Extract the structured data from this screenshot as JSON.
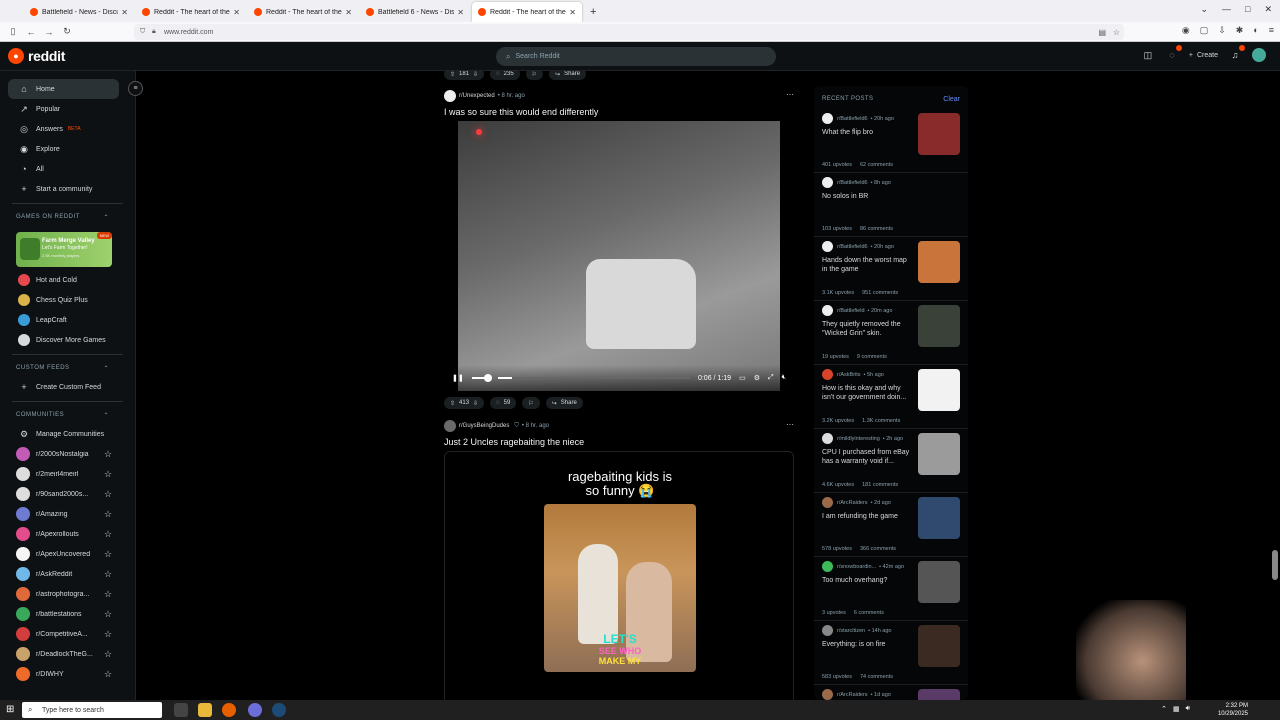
{
  "browser": {
    "tabs": [
      {
        "label": "Battlefield - News - Discussion",
        "active": false
      },
      {
        "label": "Reddit - The heart of the intern",
        "active": false
      },
      {
        "label": "Reddit - The heart of the intern",
        "active": false
      },
      {
        "label": "Battlefield 6 - News - Discussion",
        "active": false
      },
      {
        "label": "Reddit - The heart of the intern",
        "active": true
      }
    ],
    "new_tab": "+",
    "close": "✕",
    "url": "www.reddit.com"
  },
  "header": {
    "logo_text": "reddit",
    "search_placeholder": "Search Reddit",
    "create_label": "Create"
  },
  "sidebar": {
    "nav": [
      {
        "label": "Home",
        "icon": "home-icon",
        "glyph": "⌂"
      },
      {
        "label": "Popular",
        "icon": "popular-icon",
        "glyph": "↗"
      },
      {
        "label": "Answers",
        "icon": "answers-icon",
        "glyph": "◎",
        "badge": "BETA"
      },
      {
        "label": "Explore",
        "icon": "explore-icon",
        "glyph": "◉"
      },
      {
        "label": "All",
        "icon": "all-icon",
        "glyph": "◔"
      },
      {
        "label": "Start a community",
        "icon": "plus-icon",
        "glyph": "+"
      }
    ],
    "games_heading": "GAMES ON REDDIT",
    "game_banner": {
      "title": "Farm Merge Valley",
      "subtitle": "Let's Farm Together!",
      "plays": "2.5K monthly players",
      "badge": "NEW"
    },
    "games": [
      {
        "label": "Hot and Cold",
        "color": "#e5484d"
      },
      {
        "label": "Chess Quiz Plus",
        "color": "#d9b24a"
      },
      {
        "label": "LeapCraft",
        "color": "#3a9bd9"
      },
      {
        "label": "Discover More Games",
        "color": "#d7dadc"
      }
    ],
    "custom_feeds_heading": "CUSTOM FEEDS",
    "create_custom_feed": "Create Custom Feed",
    "communities_heading": "COMMUNITIES",
    "manage_communities": "Manage Communities",
    "communities": [
      {
        "name": "r/2000sNostalgia",
        "color": "#c25bb5"
      },
      {
        "name": "r/2meirl4meirl",
        "color": "#ddd"
      },
      {
        "name": "r/90sand2000s...",
        "color": "#ddd"
      },
      {
        "name": "r/Amazing",
        "color": "#6d7bd1"
      },
      {
        "name": "r/Apexrollouts",
        "color": "#e44c8b"
      },
      {
        "name": "r/ApexUncovered",
        "color": "#f5f5f5"
      },
      {
        "name": "r/AskReddit",
        "color": "#6fb8e8"
      },
      {
        "name": "r/astrophotogra...",
        "color": "#e0693a"
      },
      {
        "name": "r/battlestations",
        "color": "#39a85b"
      },
      {
        "name": "r/CompetitiveA...",
        "color": "#d33d3d"
      },
      {
        "name": "r/DeadlockTheG...",
        "color": "#c8a268"
      },
      {
        "name": "r/DIWHY",
        "color": "#ef6b2a"
      }
    ]
  },
  "feed": {
    "top_actions": {
      "upvotes": "181",
      "comments": "235",
      "share": "Share"
    },
    "post1": {
      "subreddit": "r/Unexpected",
      "time": "• 8 hr. ago",
      "title": "I was so sure this would end differently",
      "video_time": "0:06 / 1:19",
      "video_progress": 0.076,
      "upvotes": "413",
      "comments": "59",
      "share": "Share"
    },
    "post2": {
      "subreddit": "r/GuysBeingDudes",
      "time": "• 8 hr. ago",
      "title": "Just 2 Uncles ragebaiting the niece",
      "caption_line1": "ragebaiting kids is",
      "caption_line2": "so funny 😭",
      "overlay_line1": "LET'S",
      "overlay_line2": "SEE WHO",
      "overlay_line3": "MAKE MY"
    }
  },
  "recent": {
    "heading": "RECENT POSTS",
    "clear": "Clear",
    "posts": [
      {
        "sub": "r/Battlefield6",
        "time": "• 20h ago",
        "title": "What the flip bro",
        "upvotes": "401 upvotes",
        "comments": "62 comments",
        "avatar": "#eee",
        "thumb": "#8a2b2b"
      },
      {
        "sub": "r/Battlefield6",
        "time": "• 8h ago",
        "title": "No solos in BR",
        "upvotes": "103 upvotes",
        "comments": "86 comments",
        "avatar": "#eee",
        "thumb": ""
      },
      {
        "sub": "r/Battlefield6",
        "time": "• 20h ago",
        "title": "Hands down the worst map in the game",
        "upvotes": "3.1K upvotes",
        "comments": "951 comments",
        "avatar": "#eee",
        "thumb": "#c9743a"
      },
      {
        "sub": "r/Battlefield",
        "time": "• 20m ago",
        "title": "They quietly removed the \"Wicked Grin\" skin.",
        "upvotes": "19 upvotes",
        "comments": "9 comments",
        "avatar": "#eee",
        "thumb": "#394139"
      },
      {
        "sub": "r/AskBrits",
        "time": "• 5h ago",
        "title": "How is this okay and why isn't our government doin...",
        "upvotes": "3.2K upvotes",
        "comments": "1.3K comments",
        "avatar": "#d8432b",
        "thumb": "#f2f2f2"
      },
      {
        "sub": "r/mildlyinteresting",
        "time": "• 2h ago",
        "title": "CPU I purchased from eBay has a warranty void if...",
        "upvotes": "4.6K upvotes",
        "comments": "181 comments",
        "avatar": "#ddd",
        "thumb": "#9b9b9b"
      },
      {
        "sub": "r/ArcRaiders",
        "time": "• 2d ago",
        "title": "I am refunding the game",
        "upvotes": "578 upvotes",
        "comments": "366 comments",
        "avatar": "#9b6a4a",
        "thumb": "#2f4a6e"
      },
      {
        "sub": "r/snowboardin...",
        "time": "• 42m ago",
        "title": "Too much overhang?",
        "upvotes": "3 upvotes",
        "comments": "6 comments",
        "avatar": "#3dbb5b",
        "thumb": "#555"
      },
      {
        "sub": "r/starcitizen",
        "time": "• 14h ago",
        "title": "Everything: is on fire",
        "upvotes": "583 upvotes",
        "comments": "74 comments",
        "avatar": "#888",
        "thumb": "#3a2a22"
      },
      {
        "sub": "r/ArcRaiders",
        "time": "• 1d ago",
        "title": "",
        "upvotes": "",
        "comments": "",
        "avatar": "#9b6a4a",
        "thumb": "#5a3a66"
      }
    ]
  },
  "taskbar": {
    "search_placeholder": "Type here to search",
    "time": "2:32 PM",
    "date": "10/29/2025"
  }
}
